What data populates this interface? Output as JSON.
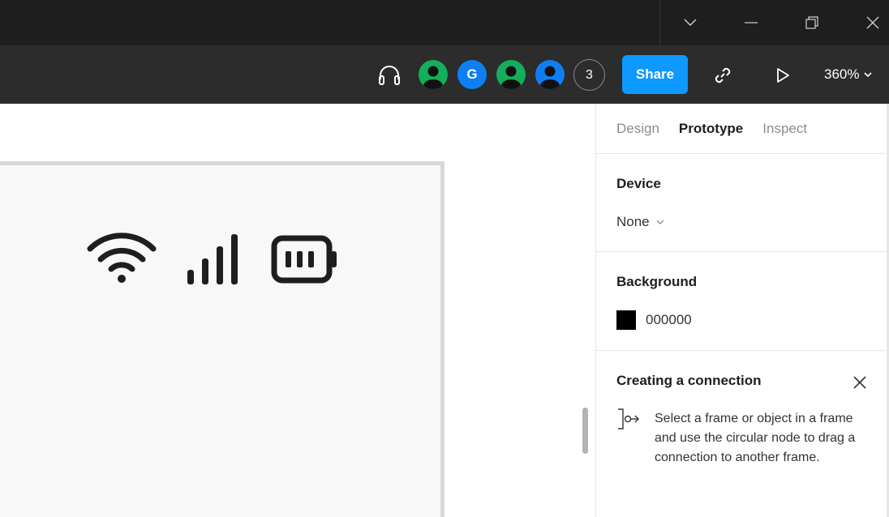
{
  "window_controls": {
    "dropdown_icon": "chevron-down-icon",
    "minimize_icon": "minimize-icon",
    "restore_icon": "restore-icon",
    "close_icon": "close-icon"
  },
  "toolbar": {
    "audio_icon": "headphones-icon",
    "avatars": [
      {
        "type": "person",
        "color": "#14ae5c"
      },
      {
        "type": "letter",
        "letter": "G",
        "color": "#0d7ff2"
      },
      {
        "type": "person",
        "color": "#14ae5c"
      },
      {
        "type": "person",
        "color": "#0d7ff2"
      }
    ],
    "extra_count": "3",
    "share_label": "Share",
    "link_icon": "link-icon",
    "present_icon": "play-icon",
    "zoom": "360%"
  },
  "canvas": {
    "status_icons": [
      "wifi-icon",
      "signal-icon",
      "battery-icon"
    ]
  },
  "panel": {
    "tabs": [
      {
        "label": "Design",
        "active": false
      },
      {
        "label": "Prototype",
        "active": true
      },
      {
        "label": "Inspect",
        "active": false
      }
    ],
    "device": {
      "title": "Device",
      "value": "None"
    },
    "background": {
      "title": "Background",
      "hex": "000000",
      "color": "#000000"
    },
    "connection": {
      "title": "Creating a connection",
      "description": "Select a frame or object in a frame and use the circular node to drag a connection to another frame."
    }
  },
  "colors": {
    "accent": "#0d99ff",
    "titlebar": "#1e1e1e",
    "toolbar": "#2c2c2c"
  }
}
